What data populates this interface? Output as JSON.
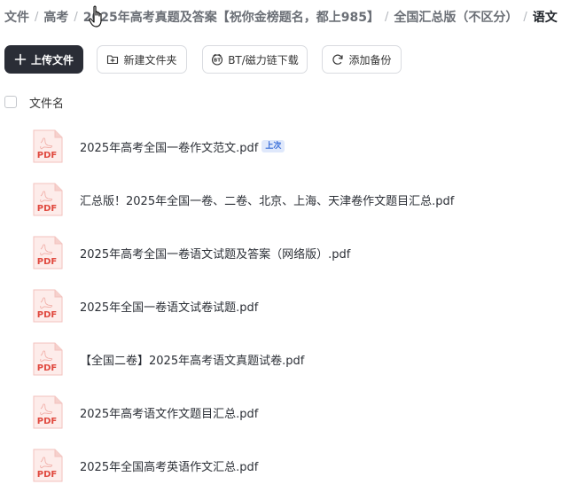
{
  "breadcrumb": {
    "items": [
      "文件",
      "高考",
      "2025年高考真题及答案【祝你金榜题名，都上985】",
      "全国汇总版（不区分）",
      "语文"
    ],
    "separator": "/"
  },
  "toolbar": {
    "upload_label": "上传文件",
    "new_folder_label": "新建文件夹",
    "bt_download_label": "BT/磁力链下载",
    "add_backup_label": "添加备份"
  },
  "list_header": {
    "name_label": "文件名"
  },
  "files": [
    {
      "name": "2025年高考全国一卷作文范文.pdf",
      "badge": "上次",
      "icon": "pdf-icon",
      "icon_label": "PDF"
    },
    {
      "name": "汇总版！2025年全国一卷、二卷、北京、上海、天津卷作文题目汇总.pdf",
      "icon": "pdf-icon",
      "icon_label": "PDF"
    },
    {
      "name": "2025年高考全国一卷语文试题及答案（网络版）.pdf",
      "icon": "pdf-icon",
      "icon_label": "PDF"
    },
    {
      "name": "2025年全国一卷语文试卷试题.pdf",
      "icon": "pdf-icon",
      "icon_label": "PDF"
    },
    {
      "name": "【全国二卷】2025年高考语文真题试卷.pdf",
      "icon": "pdf-icon",
      "icon_label": "PDF"
    },
    {
      "name": "2025年高考语文作文题目汇总.pdf",
      "icon": "pdf-icon",
      "icon_label": "PDF"
    },
    {
      "name": "2025年全国高考英语作文汇总.pdf",
      "icon": "pdf-icon",
      "icon_label": "PDF"
    }
  ],
  "colors": {
    "primary_button": "#2a2d36",
    "pdf_red": "#e0493f",
    "badge_bg": "#dfe8fb",
    "badge_text": "#3b6fd8"
  }
}
